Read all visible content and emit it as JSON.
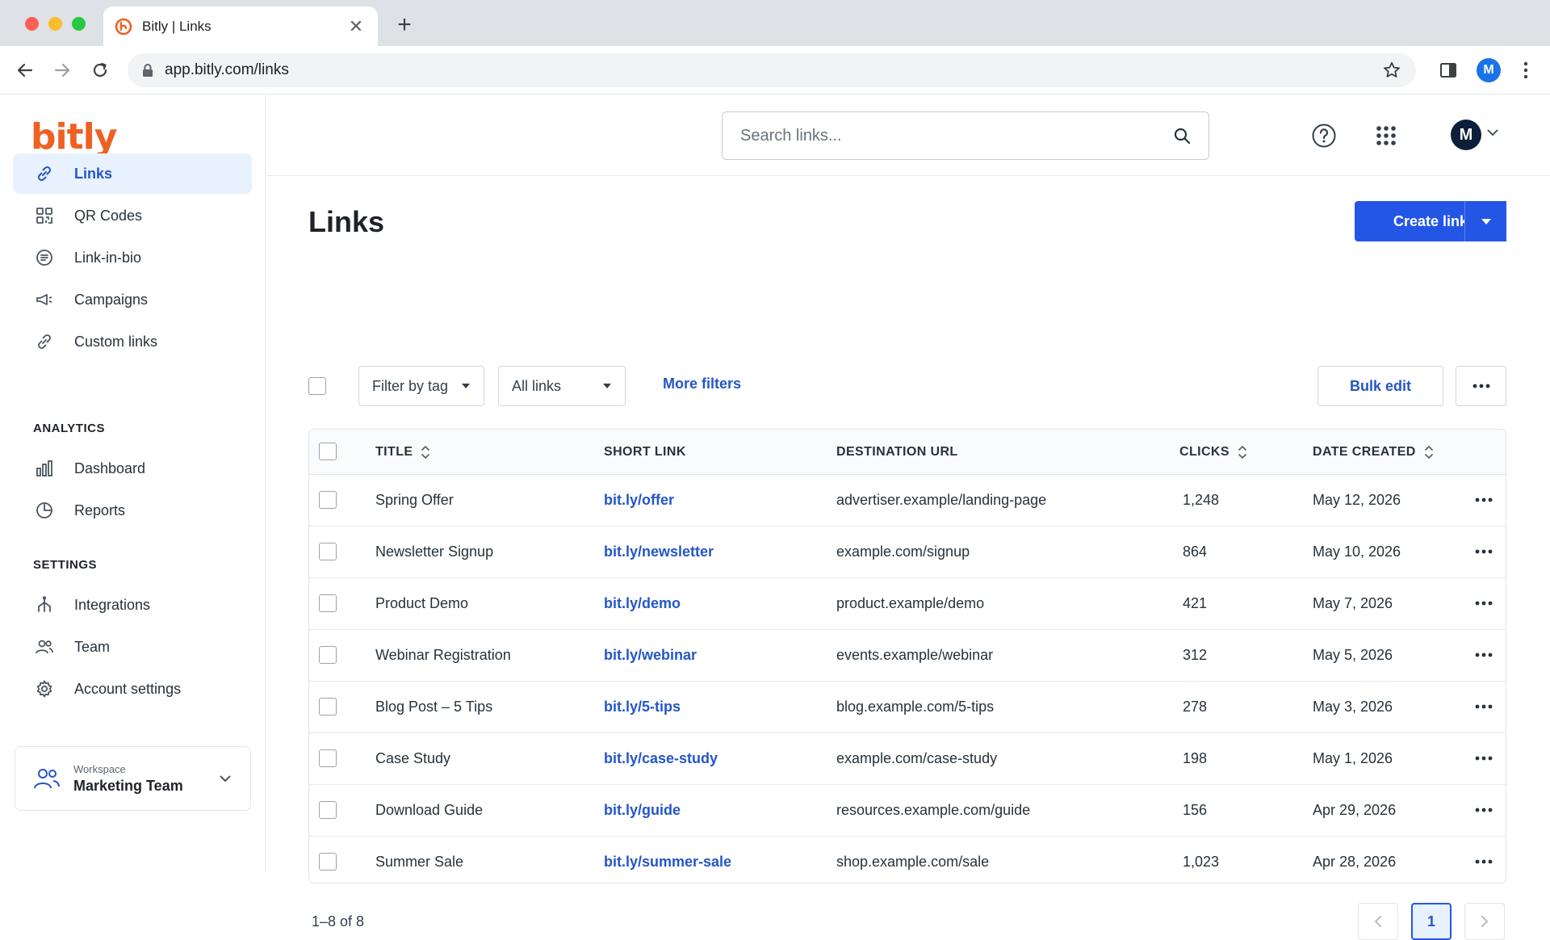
{
  "browser": {
    "tab_title": "Bitly | Links",
    "tab_close": "✕",
    "new_tab": "+",
    "url": "app.bitly.com/links",
    "profile_initial": "M"
  },
  "app": {
    "logo": "bitly",
    "brand_color": "#ee6123",
    "accent_color": "#2456e6"
  },
  "sidebar": {
    "items": [
      {
        "label": "Links",
        "icon": "link-icon",
        "active": true
      },
      {
        "label": "QR Codes",
        "icon": "qr-code-icon"
      },
      {
        "label": "Link-in-bio",
        "icon": "link-in-bio-icon"
      },
      {
        "label": "Campaigns",
        "icon": "campaigns-icon"
      },
      {
        "label": "Custom links",
        "icon": "custom-link-icon"
      }
    ],
    "analytics_heading": "ANALYTICS",
    "analytics_items": [
      {
        "label": "Dashboard",
        "icon": "bar-chart-icon"
      },
      {
        "label": "Reports",
        "icon": "pie-chart-icon"
      }
    ],
    "settings_heading": "SETTINGS",
    "settings_items": [
      {
        "label": "Integrations",
        "icon": "integrations-icon"
      },
      {
        "label": "Team",
        "icon": "team-icon"
      },
      {
        "label": "Account settings",
        "icon": "gear-icon"
      }
    ],
    "workspace": {
      "label": "Workspace",
      "name": "Marketing Team"
    }
  },
  "topbar": {
    "search_placeholder": "Search links...",
    "user_initial": "M"
  },
  "main": {
    "title": "Links",
    "create_label": "Create link",
    "filter_by_tag": "Filter by tag",
    "all_links": "All links",
    "more_filters": "More filters",
    "bulk_edit": "Bulk edit"
  },
  "table": {
    "headers": {
      "title": "TITLE",
      "short_link": "SHORT LINK",
      "destination": "DESTINATION URL",
      "clicks": "CLICKS",
      "date_created": "DATE CREATED"
    },
    "rows": [
      {
        "title": "Spring Offer",
        "short": "bit.ly/offer",
        "dest": "advertiser.example/landing-page",
        "clicks": "1,248",
        "date": "May 12, 2026"
      },
      {
        "title": "Newsletter Signup",
        "short": "bit.ly/newsletter",
        "dest": "example.com/signup",
        "clicks": "864",
        "date": "May 10, 2026"
      },
      {
        "title": "Product Demo",
        "short": "bit.ly/demo",
        "dest": "product.example/demo",
        "clicks": "421",
        "date": "May 7, 2026"
      },
      {
        "title": "Webinar Registration",
        "short": "bit.ly/webinar",
        "dest": "events.example/webinar",
        "clicks": "312",
        "date": "May 5, 2026"
      },
      {
        "title": "Blog Post – 5 Tips",
        "short": "bit.ly/5-tips",
        "dest": "blog.example.com/5-tips",
        "clicks": "278",
        "date": "May 3, 2026"
      },
      {
        "title": "Case Study",
        "short": "bit.ly/case-study",
        "dest": "example.com/case-study",
        "clicks": "198",
        "date": "May 1, 2026"
      },
      {
        "title": "Download Guide",
        "short": "bit.ly/guide",
        "dest": "resources.example.com/guide",
        "clicks": "156",
        "date": "Apr 29, 2026"
      },
      {
        "title": "Summer Sale",
        "short": "bit.ly/summer-sale",
        "dest": "shop.example.com/sale",
        "clicks": "1,023",
        "date": "Apr 28, 2026"
      }
    ]
  },
  "pagination": {
    "summary": "1–8 of 8",
    "current_page": "1"
  }
}
